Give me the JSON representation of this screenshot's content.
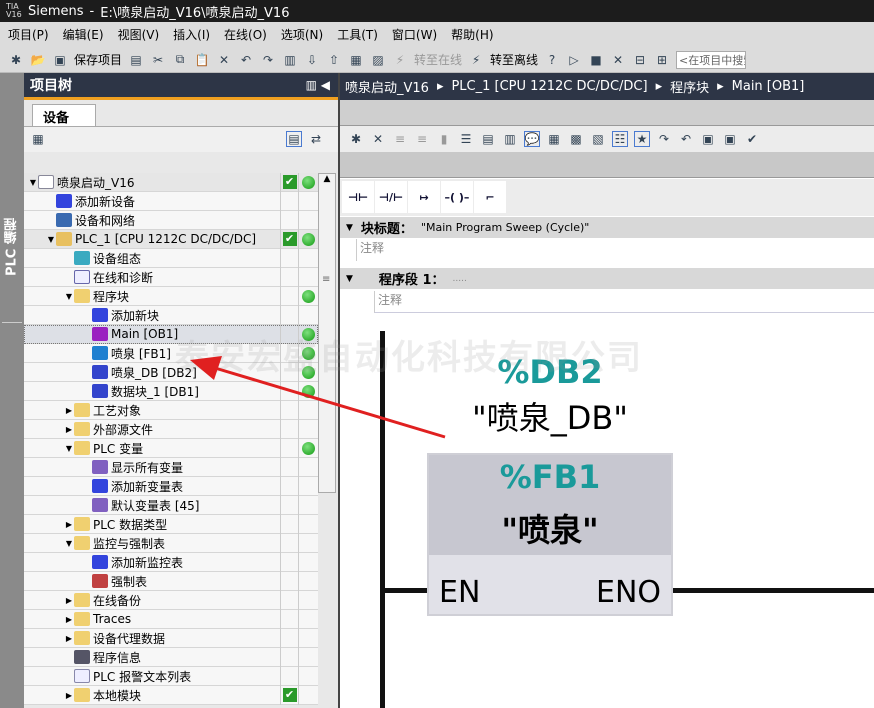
{
  "titlebar": {
    "app": "Siemens",
    "path": "E:\\喷泉启动_V16\\喷泉启动_V16",
    "logo": "TIA V16"
  },
  "menu": [
    "项目(P)",
    "编辑(E)",
    "视图(V)",
    "插入(I)",
    "在线(O)",
    "选项(N)",
    "工具(T)",
    "窗口(W)",
    "帮助(H)"
  ],
  "toolbar": {
    "save_label": "保存项目",
    "go_online": "转至在线",
    "go_offline": "转至离线",
    "search_placeholder": "<在项目中搜索>"
  },
  "sidebar": {
    "vertical_tab": "PLC 编程",
    "title": "项目树",
    "device_tab": "设备"
  },
  "tree": [
    {
      "label": "喷泉启动_V16",
      "level": 0,
      "toggle": "▼",
      "icon": "project-icon",
      "check": true,
      "dot": true
    },
    {
      "label": "添加新设备",
      "level": 1,
      "icon": "add-icon"
    },
    {
      "label": "设备和网络",
      "level": 1,
      "icon": "network-icon"
    },
    {
      "label": "PLC_1 [CPU 1212C DC/DC/DC]",
      "level": 1,
      "toggle": "▼",
      "icon": "plc-icon",
      "check": true,
      "dot": true
    },
    {
      "label": "设备组态",
      "level": 2,
      "icon": "device-config-icon"
    },
    {
      "label": "在线和诊断",
      "level": 2,
      "icon": "diagnostics-icon"
    },
    {
      "label": "程序块",
      "level": 2,
      "toggle": "▼",
      "icon": "folder-icon",
      "dot": true
    },
    {
      "label": "添加新块",
      "level": 3,
      "icon": "add-icon"
    },
    {
      "label": "Main [OB1]",
      "level": 3,
      "icon": "ob-icon",
      "dot": true,
      "selected": true
    },
    {
      "label": "喷泉 [FB1]",
      "level": 3,
      "icon": "fb-icon",
      "dot": true
    },
    {
      "label": "喷泉_DB [DB2]",
      "level": 3,
      "icon": "db-icon",
      "dot": true
    },
    {
      "label": "数据块_1 [DB1]",
      "level": 3,
      "icon": "db-icon",
      "dot": true
    },
    {
      "label": "工艺对象",
      "level": 2,
      "toggle": "▶",
      "icon": "folder-icon"
    },
    {
      "label": "外部源文件",
      "level": 2,
      "toggle": "▶",
      "icon": "folder-icon"
    },
    {
      "label": "PLC 变量",
      "level": 2,
      "toggle": "▼",
      "icon": "folder-icon",
      "dot": true
    },
    {
      "label": "显示所有变量",
      "level": 3,
      "icon": "tags-icon"
    },
    {
      "label": "添加新变量表",
      "level": 3,
      "icon": "add-icon"
    },
    {
      "label": "默认变量表 [45]",
      "level": 3,
      "icon": "tags-icon"
    },
    {
      "label": "PLC 数据类型",
      "level": 2,
      "toggle": "▶",
      "icon": "folder-icon"
    },
    {
      "label": "监控与强制表",
      "level": 2,
      "toggle": "▼",
      "icon": "folder-icon"
    },
    {
      "label": "添加新监控表",
      "level": 3,
      "icon": "add-icon"
    },
    {
      "label": "强制表",
      "level": 3,
      "icon": "force-table-icon"
    },
    {
      "label": "在线备份",
      "level": 2,
      "toggle": "▶",
      "icon": "folder-icon"
    },
    {
      "label": "Traces",
      "level": 2,
      "toggle": "▶",
      "icon": "folder-icon"
    },
    {
      "label": "设备代理数据",
      "level": 2,
      "toggle": "▶",
      "icon": "folder-icon"
    },
    {
      "label": "程序信息",
      "level": 2,
      "icon": "info-icon"
    },
    {
      "label": "PLC 报警文本列表",
      "level": 2,
      "icon": "document-icon"
    },
    {
      "label": "本地模块",
      "level": 2,
      "toggle": "▶",
      "icon": "folder-icon",
      "check": true
    }
  ],
  "breadcrumb": [
    "喷泉启动_V16",
    "PLC_1 [CPU 1212C DC/DC/DC]",
    "程序块",
    "Main [OB1]"
  ],
  "instructions": [
    "⊣⊢",
    "⊣/⊢",
    "↦",
    "–( )–",
    "⌐"
  ],
  "editor": {
    "block_title_label": "块标题：",
    "block_title": "\"Main Program Sweep (Cycle)\"",
    "comment": "注释",
    "network_label": "程序段 1：",
    "network_title": ".....",
    "network_comment": "注释"
  },
  "ladder": {
    "db_address": "%DB2",
    "db_name": "\"喷泉_DB\"",
    "fb_address": "%FB1",
    "fb_name": "\"喷泉\"",
    "en": "EN",
    "eno": "ENO"
  },
  "watermark": "泰安宏盛自动化科技有限公司",
  "colors": {
    "header": "#2d3546",
    "accent": "#f0a020",
    "address": "#1a9a9a",
    "arrow": "#e02020"
  }
}
